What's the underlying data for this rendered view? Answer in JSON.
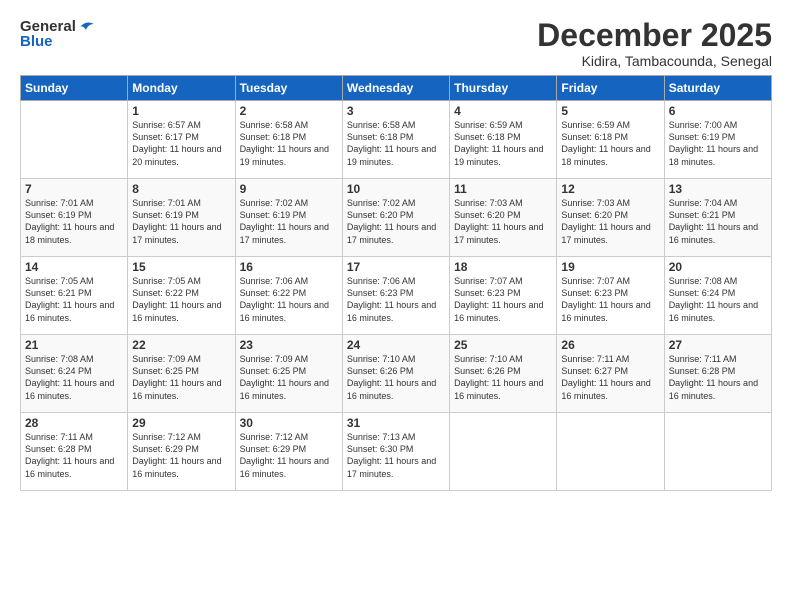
{
  "logo": {
    "line1": "General",
    "line2": "Blue"
  },
  "title": "December 2025",
  "subtitle": "Kidira, Tambacounda, Senegal",
  "headers": [
    "Sunday",
    "Monday",
    "Tuesday",
    "Wednesday",
    "Thursday",
    "Friday",
    "Saturday"
  ],
  "weeks": [
    [
      {
        "day": "",
        "sunrise": "",
        "sunset": "",
        "daylight": ""
      },
      {
        "day": "1",
        "sunrise": "Sunrise: 6:57 AM",
        "sunset": "Sunset: 6:17 PM",
        "daylight": "Daylight: 11 hours and 20 minutes."
      },
      {
        "day": "2",
        "sunrise": "Sunrise: 6:58 AM",
        "sunset": "Sunset: 6:18 PM",
        "daylight": "Daylight: 11 hours and 19 minutes."
      },
      {
        "day": "3",
        "sunrise": "Sunrise: 6:58 AM",
        "sunset": "Sunset: 6:18 PM",
        "daylight": "Daylight: 11 hours and 19 minutes."
      },
      {
        "day": "4",
        "sunrise": "Sunrise: 6:59 AM",
        "sunset": "Sunset: 6:18 PM",
        "daylight": "Daylight: 11 hours and 19 minutes."
      },
      {
        "day": "5",
        "sunrise": "Sunrise: 6:59 AM",
        "sunset": "Sunset: 6:18 PM",
        "daylight": "Daylight: 11 hours and 18 minutes."
      },
      {
        "day": "6",
        "sunrise": "Sunrise: 7:00 AM",
        "sunset": "Sunset: 6:19 PM",
        "daylight": "Daylight: 11 hours and 18 minutes."
      }
    ],
    [
      {
        "day": "7",
        "sunrise": "Sunrise: 7:01 AM",
        "sunset": "Sunset: 6:19 PM",
        "daylight": "Daylight: 11 hours and 18 minutes."
      },
      {
        "day": "8",
        "sunrise": "Sunrise: 7:01 AM",
        "sunset": "Sunset: 6:19 PM",
        "daylight": "Daylight: 11 hours and 17 minutes."
      },
      {
        "day": "9",
        "sunrise": "Sunrise: 7:02 AM",
        "sunset": "Sunset: 6:19 PM",
        "daylight": "Daylight: 11 hours and 17 minutes."
      },
      {
        "day": "10",
        "sunrise": "Sunrise: 7:02 AM",
        "sunset": "Sunset: 6:20 PM",
        "daylight": "Daylight: 11 hours and 17 minutes."
      },
      {
        "day": "11",
        "sunrise": "Sunrise: 7:03 AM",
        "sunset": "Sunset: 6:20 PM",
        "daylight": "Daylight: 11 hours and 17 minutes."
      },
      {
        "day": "12",
        "sunrise": "Sunrise: 7:03 AM",
        "sunset": "Sunset: 6:20 PM",
        "daylight": "Daylight: 11 hours and 17 minutes."
      },
      {
        "day": "13",
        "sunrise": "Sunrise: 7:04 AM",
        "sunset": "Sunset: 6:21 PM",
        "daylight": "Daylight: 11 hours and 16 minutes."
      }
    ],
    [
      {
        "day": "14",
        "sunrise": "Sunrise: 7:05 AM",
        "sunset": "Sunset: 6:21 PM",
        "daylight": "Daylight: 11 hours and 16 minutes."
      },
      {
        "day": "15",
        "sunrise": "Sunrise: 7:05 AM",
        "sunset": "Sunset: 6:22 PM",
        "daylight": "Daylight: 11 hours and 16 minutes."
      },
      {
        "day": "16",
        "sunrise": "Sunrise: 7:06 AM",
        "sunset": "Sunset: 6:22 PM",
        "daylight": "Daylight: 11 hours and 16 minutes."
      },
      {
        "day": "17",
        "sunrise": "Sunrise: 7:06 AM",
        "sunset": "Sunset: 6:23 PM",
        "daylight": "Daylight: 11 hours and 16 minutes."
      },
      {
        "day": "18",
        "sunrise": "Sunrise: 7:07 AM",
        "sunset": "Sunset: 6:23 PM",
        "daylight": "Daylight: 11 hours and 16 minutes."
      },
      {
        "day": "19",
        "sunrise": "Sunrise: 7:07 AM",
        "sunset": "Sunset: 6:23 PM",
        "daylight": "Daylight: 11 hours and 16 minutes."
      },
      {
        "day": "20",
        "sunrise": "Sunrise: 7:08 AM",
        "sunset": "Sunset: 6:24 PM",
        "daylight": "Daylight: 11 hours and 16 minutes."
      }
    ],
    [
      {
        "day": "21",
        "sunrise": "Sunrise: 7:08 AM",
        "sunset": "Sunset: 6:24 PM",
        "daylight": "Daylight: 11 hours and 16 minutes."
      },
      {
        "day": "22",
        "sunrise": "Sunrise: 7:09 AM",
        "sunset": "Sunset: 6:25 PM",
        "daylight": "Daylight: 11 hours and 16 minutes."
      },
      {
        "day": "23",
        "sunrise": "Sunrise: 7:09 AM",
        "sunset": "Sunset: 6:25 PM",
        "daylight": "Daylight: 11 hours and 16 minutes."
      },
      {
        "day": "24",
        "sunrise": "Sunrise: 7:10 AM",
        "sunset": "Sunset: 6:26 PM",
        "daylight": "Daylight: 11 hours and 16 minutes."
      },
      {
        "day": "25",
        "sunrise": "Sunrise: 7:10 AM",
        "sunset": "Sunset: 6:26 PM",
        "daylight": "Daylight: 11 hours and 16 minutes."
      },
      {
        "day": "26",
        "sunrise": "Sunrise: 7:11 AM",
        "sunset": "Sunset: 6:27 PM",
        "daylight": "Daylight: 11 hours and 16 minutes."
      },
      {
        "day": "27",
        "sunrise": "Sunrise: 7:11 AM",
        "sunset": "Sunset: 6:28 PM",
        "daylight": "Daylight: 11 hours and 16 minutes."
      }
    ],
    [
      {
        "day": "28",
        "sunrise": "Sunrise: 7:11 AM",
        "sunset": "Sunset: 6:28 PM",
        "daylight": "Daylight: 11 hours and 16 minutes."
      },
      {
        "day": "29",
        "sunrise": "Sunrise: 7:12 AM",
        "sunset": "Sunset: 6:29 PM",
        "daylight": "Daylight: 11 hours and 16 minutes."
      },
      {
        "day": "30",
        "sunrise": "Sunrise: 7:12 AM",
        "sunset": "Sunset: 6:29 PM",
        "daylight": "Daylight: 11 hours and 16 minutes."
      },
      {
        "day": "31",
        "sunrise": "Sunrise: 7:13 AM",
        "sunset": "Sunset: 6:30 PM",
        "daylight": "Daylight: 11 hours and 17 minutes."
      },
      {
        "day": "",
        "sunrise": "",
        "sunset": "",
        "daylight": ""
      },
      {
        "day": "",
        "sunrise": "",
        "sunset": "",
        "daylight": ""
      },
      {
        "day": "",
        "sunrise": "",
        "sunset": "",
        "daylight": ""
      }
    ]
  ]
}
